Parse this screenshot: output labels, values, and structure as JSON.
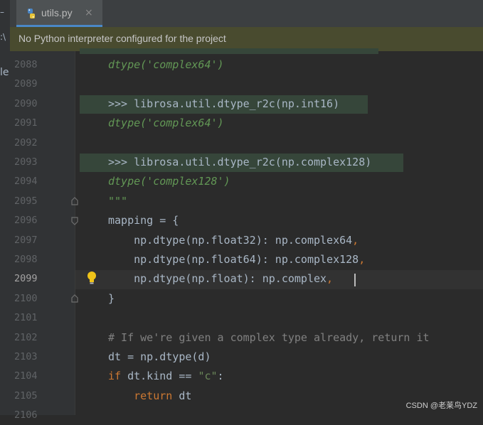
{
  "tab": {
    "filename": "utils.py",
    "close_glyph": "×"
  },
  "left_strip": {
    "glyph_top": "–",
    "glyph_mid": ":\\",
    "glyph_low": "le"
  },
  "banner": {
    "message": "No Python interpreter configured for the project"
  },
  "watermark": "CSDN @老莱鸟YDZ",
  "editor": {
    "current_line": "2099",
    "lines": [
      {
        "num": "2088",
        "segments": [
          {
            "cls": "it",
            "text": "dtype('complex64')"
          }
        ]
      },
      {
        "num": "2089",
        "segments": []
      },
      {
        "num": "2090",
        "segments": [
          {
            "cls": "",
            "text": ">>> librosa.util.dtype_r2c(np.int16)"
          }
        ]
      },
      {
        "num": "2091",
        "segments": [
          {
            "cls": "it",
            "text": "dtype('complex64')"
          }
        ]
      },
      {
        "num": "2092",
        "segments": []
      },
      {
        "num": "2093",
        "segments": [
          {
            "cls": "",
            "text": ">>> librosa.util.dtype_r2c(np.complex128)"
          }
        ]
      },
      {
        "num": "2094",
        "segments": [
          {
            "cls": "it",
            "text": "dtype('complex128')"
          }
        ]
      },
      {
        "num": "2095",
        "segments": [
          {
            "cls": "it",
            "text": "\"\"\""
          }
        ]
      },
      {
        "num": "2096",
        "segments": [
          {
            "cls": "",
            "text": "mapping = {"
          }
        ]
      },
      {
        "num": "2097",
        "segments": [
          {
            "cls": "",
            "text": "    np.dtype(np.float32): np.complex64"
          },
          {
            "cls": "kw",
            "text": ","
          }
        ]
      },
      {
        "num": "2098",
        "segments": [
          {
            "cls": "",
            "text": "    np.dtype(np.float64): np.complex128"
          },
          {
            "cls": "kw",
            "text": ","
          }
        ]
      },
      {
        "num": "2099",
        "segments": [
          {
            "cls": "",
            "text": "    np.dtype(np.float): np.complex"
          },
          {
            "cls": "kw",
            "text": ","
          }
        ]
      },
      {
        "num": "2100",
        "segments": [
          {
            "cls": "",
            "text": "}"
          }
        ]
      },
      {
        "num": "2101",
        "segments": []
      },
      {
        "num": "2102",
        "segments": [
          {
            "cls": "cm",
            "text": "# If we're given a complex type already, return it"
          }
        ]
      },
      {
        "num": "2103",
        "segments": [
          {
            "cls": "",
            "text": "dt = np.dtype(d)"
          }
        ]
      },
      {
        "num": "2104",
        "segments": [
          {
            "cls": "kw",
            "text": "if "
          },
          {
            "cls": "",
            "text": "dt.kind == "
          },
          {
            "cls": "str",
            "text": "\"c\""
          },
          {
            "cls": "",
            "text": ":"
          }
        ]
      },
      {
        "num": "2105",
        "segments": [
          {
            "cls": "kw",
            "text": "    return "
          },
          {
            "cls": "",
            "text": "dt"
          }
        ]
      },
      {
        "num": "2106",
        "segments": []
      }
    ]
  }
}
